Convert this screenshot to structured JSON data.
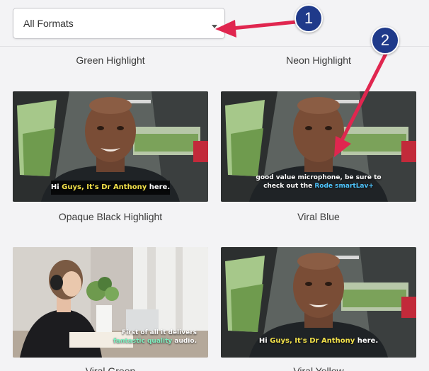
{
  "format_select": {
    "value": "All Formats"
  },
  "badges": [
    "1",
    "2"
  ],
  "cards": [
    {
      "label": "Green Highlight"
    },
    {
      "label": "Neon Highlight"
    },
    {
      "label": "Opaque Black Highlight",
      "caption": {
        "pre": "Hi ",
        "hl": "Guys, It's Dr Anthony",
        "post": " here."
      }
    },
    {
      "label": "Viral Blue",
      "caption": {
        "line1": "good value microphone, be sure to",
        "pre": "check out the ",
        "hl": "Rode smartLav+"
      }
    },
    {
      "label": "Viral Green",
      "caption": {
        "line1": "First of all it delivers",
        "hl": "fantastic quality",
        "post": " audio."
      }
    },
    {
      "label": "Viral Yellow",
      "caption": {
        "pre": "Hi ",
        "hl": "Guys, It's Dr Anthony",
        "post": " here."
      }
    }
  ],
  "colors": {
    "badge": "#1f3a8a",
    "arrow": "#e0264f"
  }
}
